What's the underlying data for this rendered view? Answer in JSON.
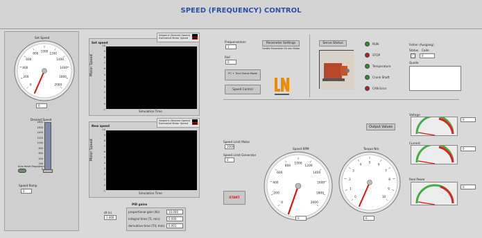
{
  "header": {
    "title": "SPEED (FREQUENCY) CONTROL"
  },
  "set_speed_gauge": {
    "label": "Set Speed",
    "ticks": [
      "0",
      "100",
      "200",
      "300",
      "400",
      "500",
      "600",
      "700",
      "800",
      "900",
      "1000",
      "1100",
      "1200",
      "1300",
      "1400",
      "1500",
      "1600",
      "1700",
      "1800",
      "1900",
      "2000"
    ],
    "value_display": "0"
  },
  "desired_speed": {
    "label": "Desired Speed",
    "slider_ticks": [
      "1800",
      "1600",
      "1400",
      "1200",
      "1000",
      "800",
      "600",
      "400",
      "200",
      "0"
    ],
    "toggle_label": "Auto Reset Regulation",
    "ramp_label": "Speed Ramp",
    "ramp_value": "0"
  },
  "set_speed_plot": {
    "title": "Set speed",
    "legend": [
      "Setpoint (Desired Speed)",
      "Estimated Motor Speed"
    ],
    "ylabel": "Motor Speed",
    "xlabel": "Simulation Time",
    "yticks": [
      "10",
      "9",
      "8",
      "7",
      "6",
      "5",
      "4",
      "3",
      "2",
      "1",
      "0",
      "-1"
    ]
  },
  "new_speed_plot": {
    "title": "New speed",
    "legend": [
      "Setpoint (Desired Speed)",
      "Estimated Motor Speed"
    ],
    "ylabel": "Motor Speed",
    "xlabel": "Simulation Time",
    "yticks": [
      "10",
      "9",
      "8",
      "7",
      "6",
      "5",
      "4",
      "3",
      "2",
      "1",
      "0",
      "-1"
    ]
  },
  "pid": {
    "title": "PID gains",
    "dt_label": "dt (s)",
    "dt_value": "1.000",
    "rows": [
      {
        "label": "proportional gain (Kc)",
        "value": "10.000"
      },
      {
        "label": "integral time (Ti, min)",
        "value": "0.000"
      },
      {
        "label": "derivative time (Td, min)",
        "value": "0.001"
      }
    ]
  },
  "controls": {
    "frequency_label": "Frequenzeinen",
    "frequency_value": "1",
    "rail_label": "Rail",
    "rail_value": "0",
    "mode_select": "PC + Test Stand Mode",
    "control_select": "Speed Control",
    "param_button": "Parameter Settings",
    "param_caption": "Geräte Parameter für den Motor"
  },
  "servo": {
    "title": "Servo Status",
    "leds": [
      {
        "label": "RUN",
        "color": "#2f8f2f"
      },
      {
        "label": "STOP",
        "color": "#b52222"
      },
      {
        "label": "Temperature",
        "color": "#2f8f2f"
      },
      {
        "label": "Crank Shaft",
        "color": "#2f8f2f"
      },
      {
        "label": "CAN Error",
        "color": "#b52222"
      }
    ]
  },
  "fehler": {
    "title": "Fehler (Ausgang)",
    "status_label": "Status",
    "code_label": "Code",
    "code_value": "0",
    "quelle_label": "Quelle"
  },
  "speed_limits": {
    "motor_label": "Speed Limit Motor",
    "motor_value": "2000",
    "generator_label": "Speed Limit Generator",
    "generator_value": "0"
  },
  "start_button": "START",
  "speed_rpm_gauge": {
    "label": "Speed RPM",
    "ticks": [
      "0",
      "100",
      "200",
      "300",
      "400",
      "500",
      "600",
      "700",
      "800",
      "900",
      "1000",
      "1100",
      "1200",
      "1300",
      "1400",
      "1500",
      "1600",
      "1700",
      "1800",
      "1900",
      "2000"
    ],
    "value_display": "0"
  },
  "torque_gauge": {
    "label": "Torque Nm",
    "ticks": [
      "0",
      "0.5",
      "1",
      "1.5",
      "2",
      "2.5",
      "3",
      "3.5",
      "4",
      "4.5",
      "5",
      "5.5",
      "6",
      "6.5",
      "7",
      "7.5",
      "8",
      "8.5",
      "9",
      "9.5",
      "10"
    ],
    "value_display": "0"
  },
  "output_values_button": "Output Values",
  "voltage": {
    "label": "Voltage",
    "ticks": [
      "0",
      "100",
      "200",
      "300",
      "400",
      "500",
      "600"
    ],
    "value_display": "0"
  },
  "current": {
    "label": "Current",
    "ticks": [
      "0",
      "2",
      "4",
      "6",
      "8",
      "10"
    ],
    "value_display": "0"
  },
  "real_power": {
    "label": "Real Power",
    "ticks": [
      "0",
      "1000",
      "2000",
      "3000",
      "4000"
    ],
    "value_display": "0"
  },
  "colors": {
    "title": "#2b4fa8",
    "needle": "#e01010",
    "plot_bg": "#000000",
    "start_text": "#c62020"
  }
}
